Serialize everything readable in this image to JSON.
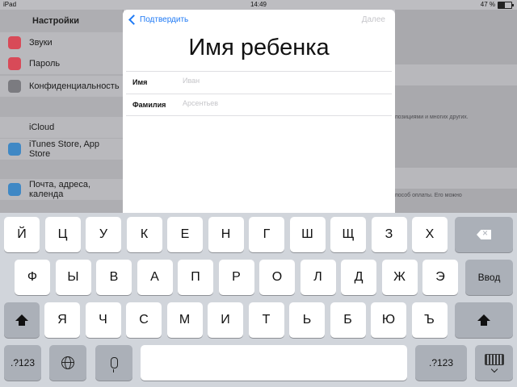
{
  "status_bar": {
    "device": "iPad",
    "time": "14:49",
    "battery": "47 %",
    "battery_level": 0.47
  },
  "background": {
    "master_title": "Настройки",
    "master_rows": [
      {
        "label": "Звуки",
        "icon": "sounds-icon",
        "color": "#d84a58"
      },
      {
        "label": "Пароль",
        "icon": "passcode-icon",
        "color": "#d84a58"
      },
      {
        "label": "Конфиденциальность",
        "icon": "privacy-hand-icon",
        "color": "#7b7b80"
      },
      {
        "label": "iCloud",
        "icon": "icloud-icon",
        "color": "#b9b9bd"
      },
      {
        "label": "iTunes Store, App Store",
        "icon": "app-store-icon",
        "color": "#3f88c5"
      },
      {
        "label": "Почта, адреса, календа",
        "icon": "mail-icon",
        "color": "#3f88c5"
      }
    ],
    "detail_texts": [
      "позициями и многих других.",
      "пособ оплаты. Его можно"
    ]
  },
  "modal": {
    "back_label": "Подтвердить",
    "next_label": "Далее",
    "title": "Имя ребенка",
    "fields": [
      {
        "label": "Имя",
        "placeholder": "Иван",
        "value": ""
      },
      {
        "label": "Фамилия",
        "placeholder": "Арсентьев",
        "value": ""
      }
    ]
  },
  "keyboard": {
    "row1": [
      "Й",
      "Ц",
      "У",
      "К",
      "Е",
      "Н",
      "Г",
      "Ш",
      "Щ",
      "З",
      "Х"
    ],
    "row2": [
      "Ф",
      "Ы",
      "В",
      "А",
      "П",
      "Р",
      "О",
      "Л",
      "Д",
      "Ж",
      "Э"
    ],
    "row3": [
      "Я",
      "Ч",
      "С",
      "М",
      "И",
      "Т",
      "Ь",
      "Б",
      "Ю",
      "Ъ"
    ],
    "return_label": "Ввод",
    "numbers_label": ".?123",
    "icons": {
      "backspace": "backspace-icon",
      "shift": "shift-icon",
      "globe": "globe-icon",
      "mic": "microphone-icon",
      "dismiss": "keyboard-dismiss-icon"
    }
  }
}
